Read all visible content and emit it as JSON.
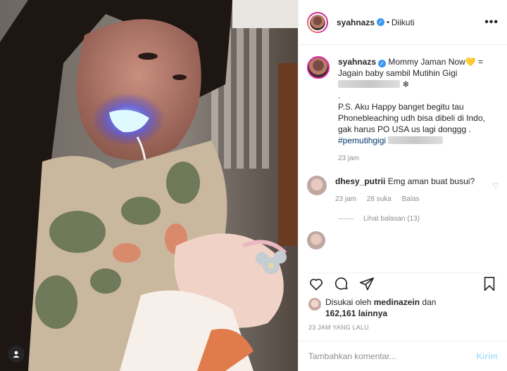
{
  "post": {
    "username": "syahnazs",
    "follow_status": "Diikuti",
    "more_label": "•••",
    "caption": {
      "line1_pre": "Mommy Jaman Now",
      "line1_emoji": "💛",
      "line1_post": "=",
      "line2": "Jagain baby sambil Mutihin Gigi",
      "line2_extra": "❄",
      "line3": ".",
      "line4": "P.S. Aku Happy banget begitu tau Phonebleaching udh bisa dibeli di Indo, gak harus PO USA us lagi donggg .",
      "hashtag": "#pemutihgigi",
      "time": "23 jam"
    },
    "comment": {
      "username": "dhesy_putrii",
      "text": "Emg aman buat busui?",
      "time": "23 jam",
      "likes": "28 suka",
      "reply": "Balas",
      "view_replies": "Lihat balasan (13)"
    },
    "liked_by": {
      "prefix": "Disukai oleh",
      "user": "medinazein",
      "joiner": "dan",
      "count": "162,161 lainnya"
    },
    "date": "23 JAM YANG LALU",
    "comment_placeholder": "Tambahkan komentar...",
    "post_button": "Kirim"
  },
  "icons": {
    "verified": "✓",
    "heart_small": "♡"
  }
}
